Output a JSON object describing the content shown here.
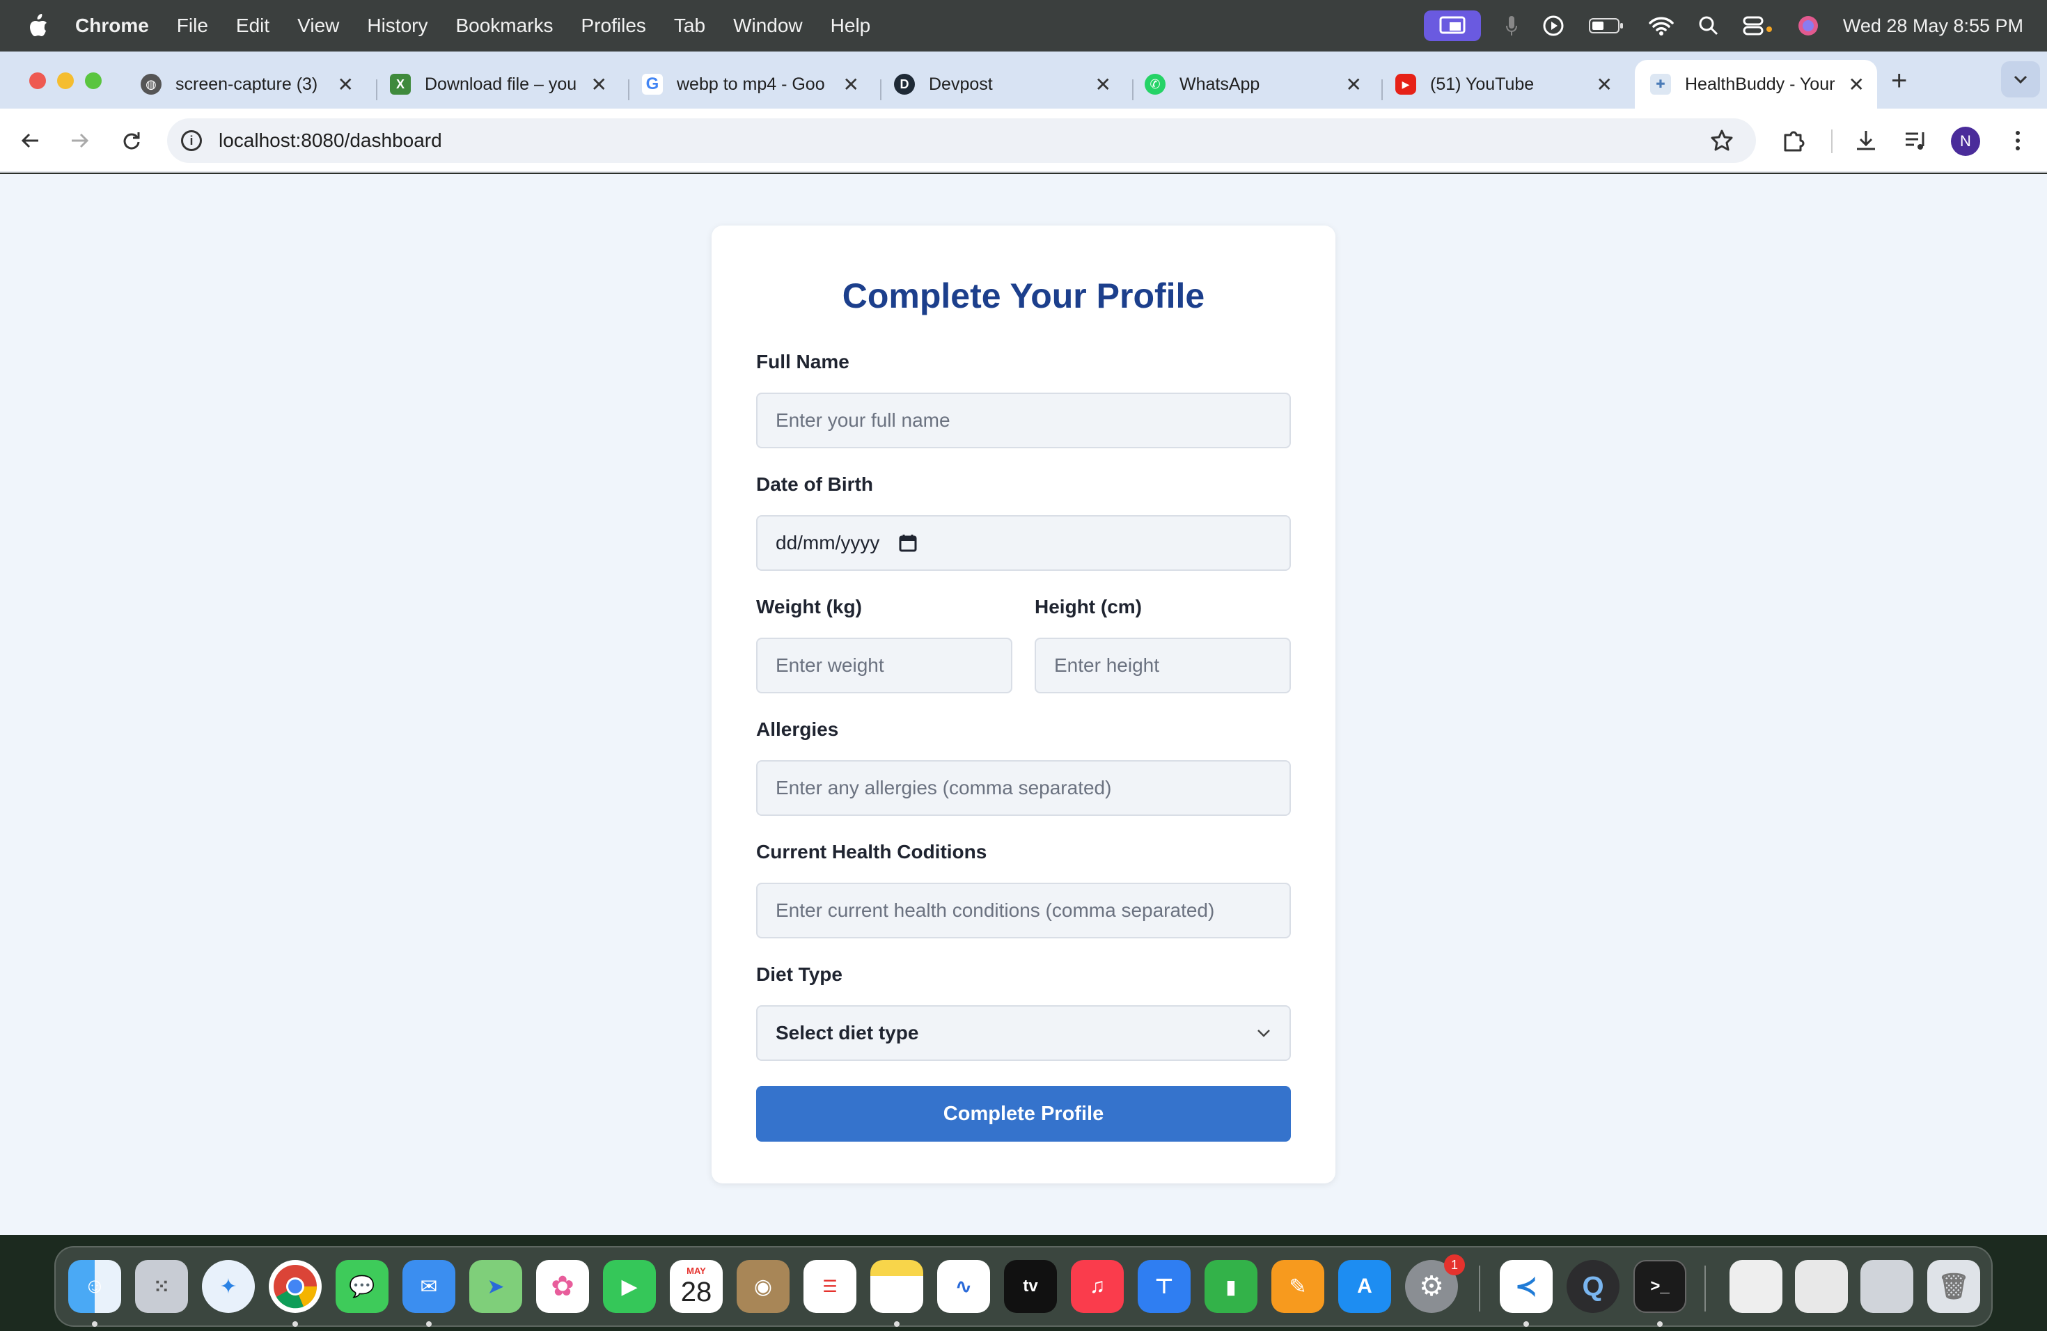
{
  "menubar": {
    "app_name": "Chrome",
    "menus": [
      "File",
      "Edit",
      "View",
      "History",
      "Bookmarks",
      "Profiles",
      "Tab",
      "Window",
      "Help"
    ],
    "clock": "Wed 28 May  8:55 PM"
  },
  "tabs": [
    {
      "title": "screen-capture (3)",
      "icon": "globe-icon",
      "active": false
    },
    {
      "title": "Download file – you",
      "icon": "download-site-icon",
      "active": false
    },
    {
      "title": "webp to mp4 - Goo",
      "icon": "google-icon",
      "active": false
    },
    {
      "title": "Devpost",
      "icon": "devpost-icon",
      "active": false
    },
    {
      "title": "WhatsApp",
      "icon": "whatsapp-icon",
      "active": false
    },
    {
      "title": "(51) YouTube",
      "icon": "youtube-icon",
      "active": false
    },
    {
      "title": "HealthBuddy - Your",
      "icon": "healthbuddy-icon",
      "active": true
    }
  ],
  "toolbar": {
    "url": "localhost:8080/dashboard",
    "profile_initial": "N"
  },
  "form": {
    "title": "Complete Your Profile",
    "full_name": {
      "label": "Full Name",
      "placeholder": "Enter your full name"
    },
    "dob": {
      "label": "Date of Birth",
      "placeholder": "dd/mm/yyyy"
    },
    "weight": {
      "label": "Weight (kg)",
      "placeholder": "Enter weight"
    },
    "height": {
      "label": "Height (cm)",
      "placeholder": "Enter height"
    },
    "allergies": {
      "label": "Allergies",
      "placeholder": "Enter any allergies (comma separated)"
    },
    "conditions": {
      "label": "Current Health Coditions",
      "placeholder": "Enter current health conditions (comma separated)"
    },
    "diet": {
      "label": "Diet Type",
      "selected": "Select diet type"
    },
    "submit_label": "Complete Profile"
  },
  "dock": {
    "apps": [
      "finder",
      "launchpad",
      "safari",
      "chrome",
      "messages",
      "mail",
      "maps",
      "photos",
      "facetime",
      "calendar",
      "contacts",
      "reminders",
      "notes",
      "freeform",
      "tv",
      "music",
      "keynote",
      "numbers",
      "pages",
      "app-store",
      "system-settings",
      "vscode",
      "quicktime",
      "terminal"
    ],
    "calendar_month": "MAY",
    "calendar_day": "28",
    "settings_badge": "1"
  },
  "colors": {
    "accent": "#3573cc",
    "title": "#1c3f8c",
    "page_bg": "#f0f5fb"
  }
}
